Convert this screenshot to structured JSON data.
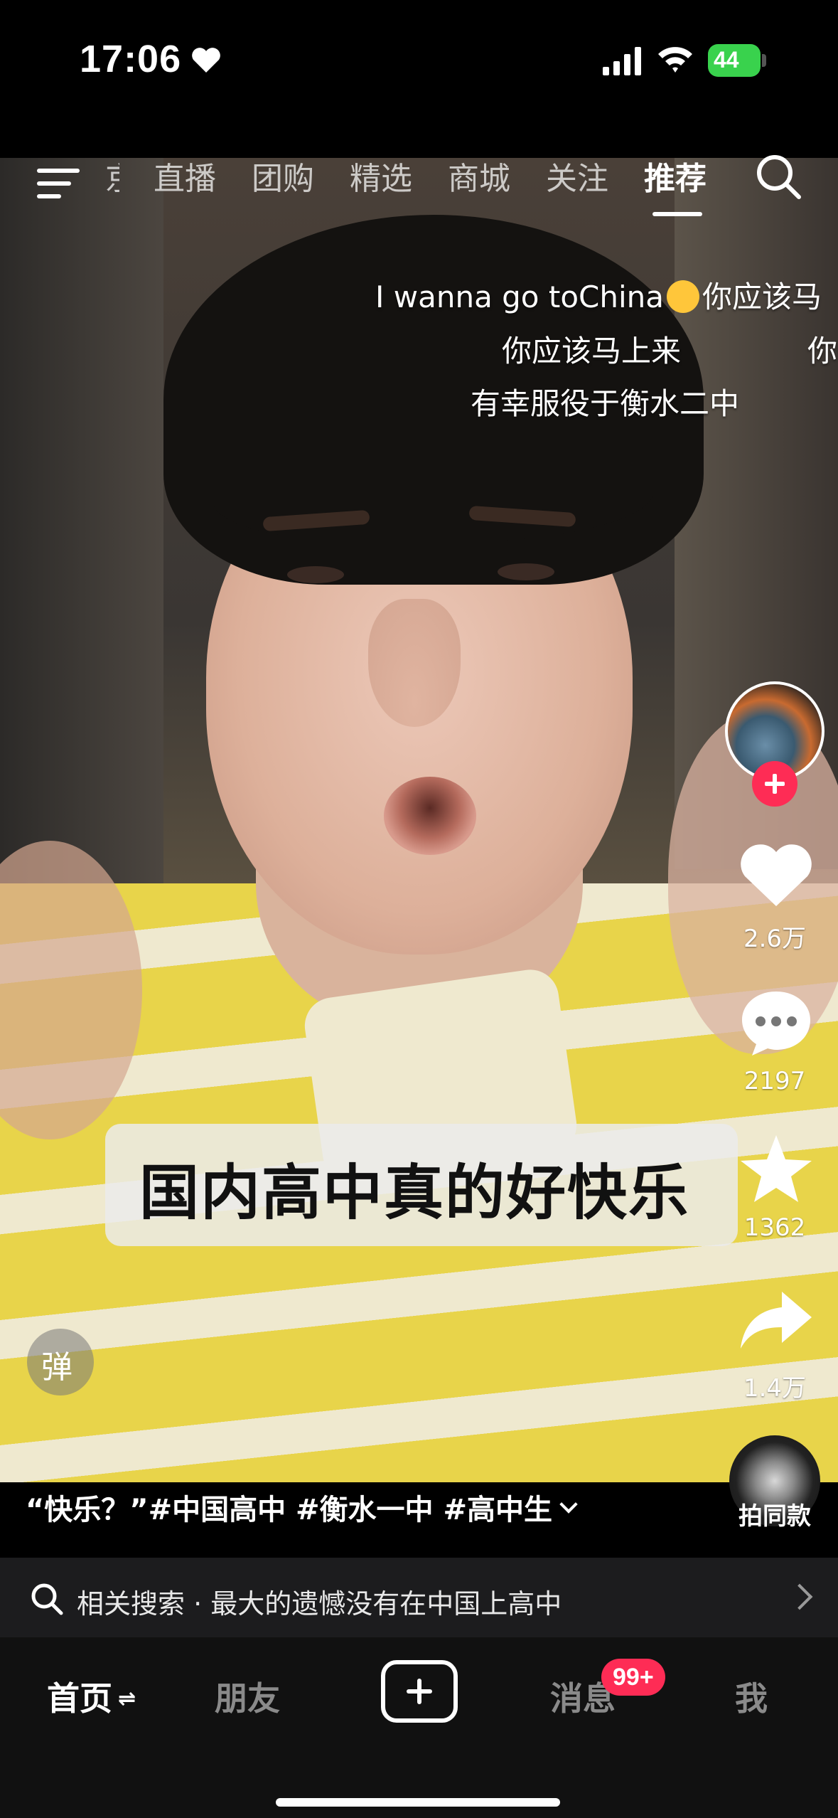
{
  "status_bar": {
    "time": "17:06",
    "battery": "44"
  },
  "top_nav": {
    "tabs": [
      {
        "label": "京"
      },
      {
        "label": "直播"
      },
      {
        "label": "团购"
      },
      {
        "label": "精选"
      },
      {
        "label": "商城"
      },
      {
        "label": "关注"
      },
      {
        "label": "推荐",
        "active": true
      }
    ]
  },
  "danmaku": [
    {
      "text_before": "I wanna go toChina",
      "text_after": "你应该马"
    },
    {
      "text": "你应该马上来"
    },
    {
      "text": "你"
    },
    {
      "text": "有幸服役于衡水二中"
    }
  ],
  "caption": "国内高中真的好快乐",
  "danmaku_toggle": "弹",
  "right_rail": {
    "likes": "2.6万",
    "comments": "2197",
    "favorites": "1362",
    "shares": "1.4万",
    "same_label": "拍同款"
  },
  "description": "“快乐？”#中国高中 #衡水一中 #高中生",
  "related_search": {
    "label": "相关搜索",
    "separator": "·",
    "query": "最大的遗憾没有在中国上高中"
  },
  "bottom_nav": {
    "home": "首页",
    "friends": "朋友",
    "messages": "消息",
    "messages_badge": "99+",
    "me": "我"
  },
  "colors": {
    "accent": "#fe2c55",
    "battery": "#39d24d"
  }
}
